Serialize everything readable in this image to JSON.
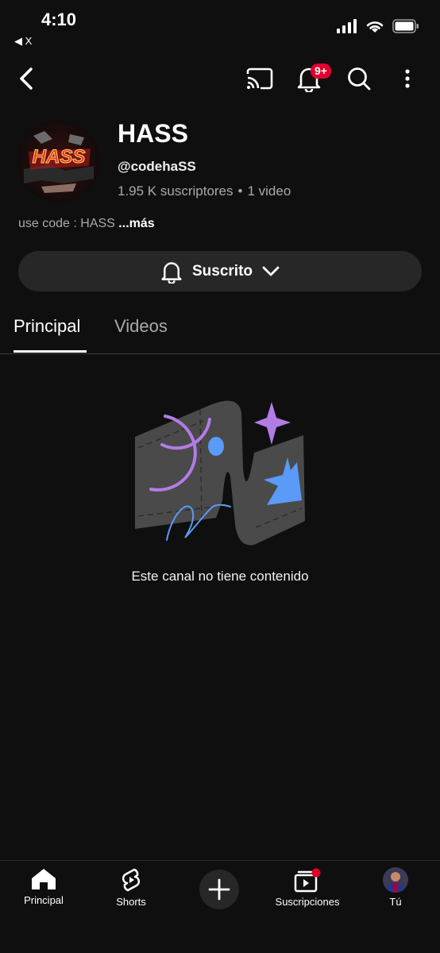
{
  "status_bar": {
    "time": "4:10",
    "back_app": "◀ X"
  },
  "topbar": {
    "notification_badge": "9+"
  },
  "channel": {
    "name": "HASS",
    "handle": "@codehaSS",
    "subscribers": "1.95 K suscriptores",
    "separator": "•",
    "videos": "1 video",
    "avatar_text": "HASS",
    "description": "use code : HASS",
    "more_label": "...más"
  },
  "subscribe_button": {
    "label": "Suscrito"
  },
  "tabs": [
    {
      "label": "Principal",
      "active": true
    },
    {
      "label": "Videos",
      "active": false
    }
  ],
  "empty_state": {
    "text": "Este canal no tiene contenido"
  },
  "bottom_nav": [
    {
      "label": "Principal",
      "icon": "home-icon"
    },
    {
      "label": "Shorts",
      "icon": "shorts-icon"
    },
    {
      "label": "",
      "icon": "plus-icon"
    },
    {
      "label": "Suscripciones",
      "icon": "subscriptions-icon"
    },
    {
      "label": "Tú",
      "icon": "user-avatar"
    }
  ],
  "colors": {
    "background": "#0f0f0f",
    "badge": "#e1002d",
    "button": "#272727",
    "muted": "#aaaaaa"
  }
}
